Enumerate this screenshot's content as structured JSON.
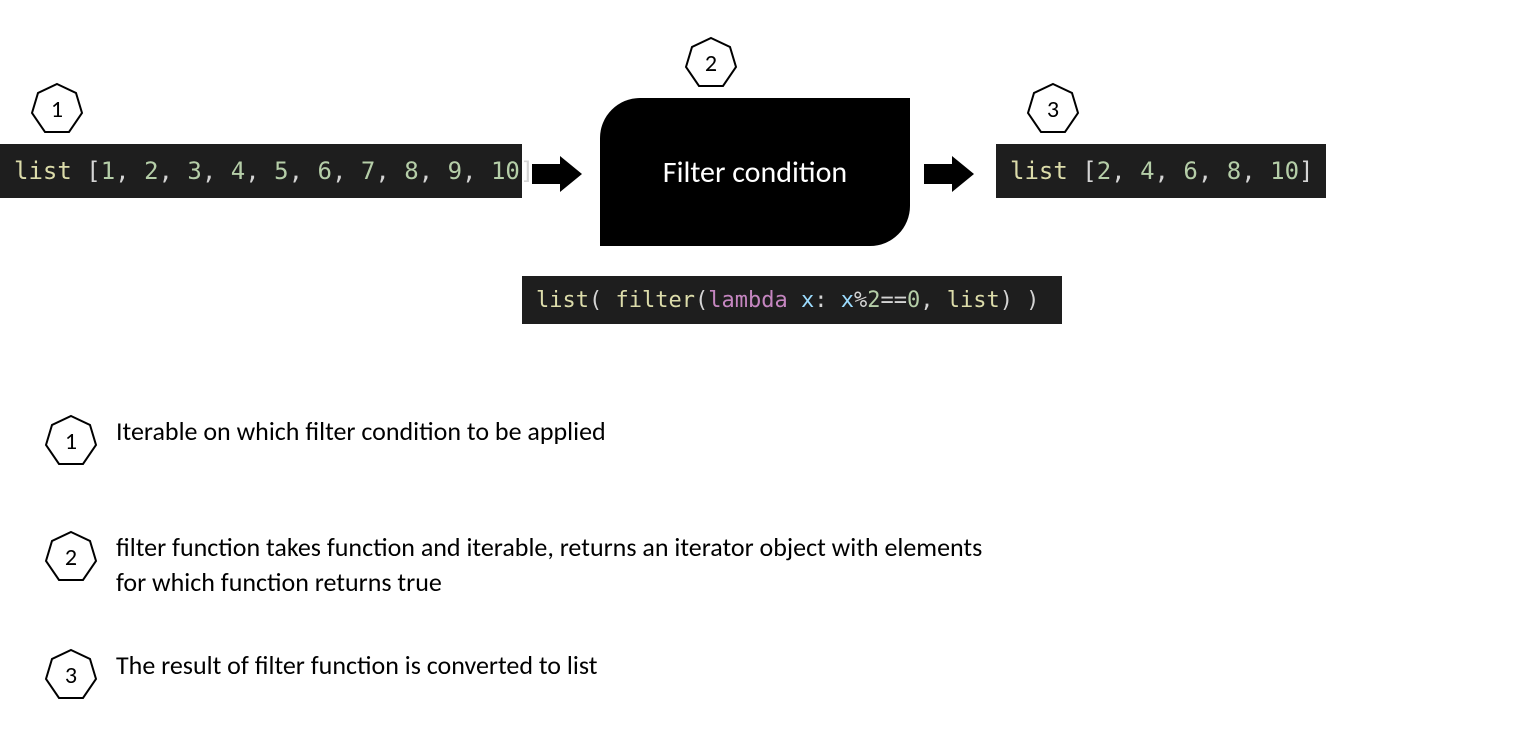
{
  "badges": {
    "b1": "1",
    "b2": "2",
    "b3": "3"
  },
  "flow": {
    "input_code": "list [1, 2, 3, 4, 5, 6, 7, 8, 9, 10]",
    "filter_label": "Filter condition",
    "output_code": "list [2, 4, 6, 8, 10]",
    "expression_code": "list( filter(lambda x: x%2==0, list) )"
  },
  "legend": {
    "l1": "Iterable on which filter condition to be applied",
    "l2": "filter function takes function and iterable, returns an iterator object with elements for which function returns true",
    "l3": "The result of filter function is converted to list"
  },
  "code_tokens": {
    "input": [
      {
        "t": "list ",
        "c": "kw-list"
      },
      {
        "t": "[",
        "c": "punct"
      },
      {
        "t": "1",
        "c": "num"
      },
      {
        "t": ", ",
        "c": "punct"
      },
      {
        "t": "2",
        "c": "num"
      },
      {
        "t": ", ",
        "c": "punct"
      },
      {
        "t": "3",
        "c": "num"
      },
      {
        "t": ", ",
        "c": "punct"
      },
      {
        "t": "4",
        "c": "num"
      },
      {
        "t": ", ",
        "c": "punct"
      },
      {
        "t": "5",
        "c": "num"
      },
      {
        "t": ", ",
        "c": "punct"
      },
      {
        "t": "6",
        "c": "num"
      },
      {
        "t": ", ",
        "c": "punct"
      },
      {
        "t": "7",
        "c": "num"
      },
      {
        "t": ", ",
        "c": "punct"
      },
      {
        "t": "8",
        "c": "num"
      },
      {
        "t": ", ",
        "c": "punct"
      },
      {
        "t": "9",
        "c": "num"
      },
      {
        "t": ", ",
        "c": "punct"
      },
      {
        "t": "10",
        "c": "num"
      },
      {
        "t": "]",
        "c": "punct"
      }
    ],
    "output": [
      {
        "t": "list ",
        "c": "kw-list"
      },
      {
        "t": "[",
        "c": "punct"
      },
      {
        "t": "2",
        "c": "num"
      },
      {
        "t": ", ",
        "c": "punct"
      },
      {
        "t": "4",
        "c": "num"
      },
      {
        "t": ", ",
        "c": "punct"
      },
      {
        "t": "6",
        "c": "num"
      },
      {
        "t": ", ",
        "c": "punct"
      },
      {
        "t": "8",
        "c": "num"
      },
      {
        "t": ", ",
        "c": "punct"
      },
      {
        "t": "10",
        "c": "num"
      },
      {
        "t": "]",
        "c": "punct"
      }
    ],
    "expression": [
      {
        "t": "list",
        "c": "kw-list"
      },
      {
        "t": "( ",
        "c": "punct"
      },
      {
        "t": "filter",
        "c": "kw-filter"
      },
      {
        "t": "(",
        "c": "punct"
      },
      {
        "t": "lambda",
        "c": "kw-lambda"
      },
      {
        "t": " ",
        "c": "punct"
      },
      {
        "t": "x",
        "c": "var"
      },
      {
        "t": ": ",
        "c": "punct"
      },
      {
        "t": "x",
        "c": "var"
      },
      {
        "t": "%",
        "c": "op"
      },
      {
        "t": "2",
        "c": "num"
      },
      {
        "t": "==",
        "c": "op"
      },
      {
        "t": "0",
        "c": "num"
      },
      {
        "t": ", ",
        "c": "punct"
      },
      {
        "t": "list",
        "c": "kw-list"
      },
      {
        "t": ") )",
        "c": "punct"
      }
    ]
  }
}
